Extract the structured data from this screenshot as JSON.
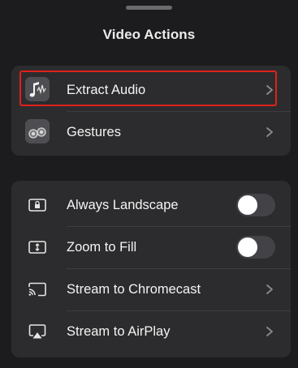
{
  "sheet": {
    "title": "Video Actions"
  },
  "group1": {
    "items": [
      {
        "label": "Extract Audio",
        "icon": "music-note-waveform-icon",
        "accessory": "chevron"
      },
      {
        "label": "Gestures",
        "icon": "gestures-icon",
        "accessory": "chevron"
      }
    ]
  },
  "group2": {
    "items": [
      {
        "label": "Always Landscape",
        "icon": "landscape-lock-icon",
        "accessory": "toggle",
        "on": false
      },
      {
        "label": "Zoom to Fill",
        "icon": "zoom-fill-icon",
        "accessory": "toggle",
        "on": false
      },
      {
        "label": "Stream to Chromecast",
        "icon": "chromecast-icon",
        "accessory": "chevron"
      },
      {
        "label": "Stream to AirPlay",
        "icon": "airplay-icon",
        "accessory": "chevron"
      }
    ]
  },
  "colors": {
    "background": "#1c1c1e",
    "group_background": "#2c2c2e",
    "highlight": "#e0201b",
    "toggle_off": "#434347"
  }
}
